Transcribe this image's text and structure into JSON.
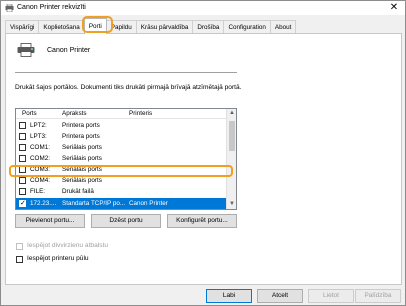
{
  "window": {
    "title": "Canon Printer rekvizīti",
    "close_glyph": "✕"
  },
  "tabs": [
    {
      "label": "Vispārīgi",
      "active": false
    },
    {
      "label": "Koplietošana",
      "active": false
    },
    {
      "label": "Porti",
      "active": true
    },
    {
      "label": "Papildu",
      "active": false
    },
    {
      "label": "Krāsu pārvaldība",
      "active": false
    },
    {
      "label": "Drošība",
      "active": false
    },
    {
      "label": "Configuration",
      "active": false
    },
    {
      "label": "About",
      "active": false
    }
  ],
  "printer": {
    "name": "Canon Printer",
    "icon": "printer-icon"
  },
  "description": "Drukāt šajos portālos. Dokumenti tiks drukāti pirmajā brīvajā atzīmētajā portā.",
  "port_list": {
    "headers": {
      "port": "Ports",
      "description": "Apraksts",
      "printer": "Printeris"
    },
    "rows": [
      {
        "port": "LPT2:",
        "description": "Printera ports",
        "printer": "",
        "checked": false,
        "selected": false
      },
      {
        "port": "LPT3:",
        "description": "Printera ports",
        "printer": "",
        "checked": false,
        "selected": false
      },
      {
        "port": "COM1:",
        "description": "Seriālais ports",
        "printer": "",
        "checked": false,
        "selected": false
      },
      {
        "port": "COM2:",
        "description": "Seriālais ports",
        "printer": "",
        "checked": false,
        "selected": false
      },
      {
        "port": "COM3:",
        "description": "Seriālais ports",
        "printer": "",
        "checked": false,
        "selected": false
      },
      {
        "port": "COM4:",
        "description": "Seriālais ports",
        "printer": "",
        "checked": false,
        "selected": false
      },
      {
        "port": "FILE:",
        "description": "Drukāt failā",
        "printer": "",
        "checked": false,
        "selected": false
      },
      {
        "port": "172.23....",
        "description": "Standarta TCP/IP po...",
        "printer": "Canon Printer",
        "checked": true,
        "selected": true
      }
    ]
  },
  "buttons": {
    "add_port": "Pievienot portu...",
    "delete_port": "Dzēst portu",
    "configure_port": "Konfigurēt portu..."
  },
  "options": {
    "bidirectional": {
      "label": "Iespējot divvirzienu atbalstu",
      "checked": false,
      "enabled": false
    },
    "pooling": {
      "label": "Iespējot printeru pūlu",
      "checked": false,
      "enabled": true
    }
  },
  "footer": {
    "ok": "Labi",
    "cancel": "Atcelt",
    "apply": "Lietot",
    "help": "Palīdzība"
  },
  "colors": {
    "highlight": "#f0a020",
    "selection": "#0078d7"
  }
}
